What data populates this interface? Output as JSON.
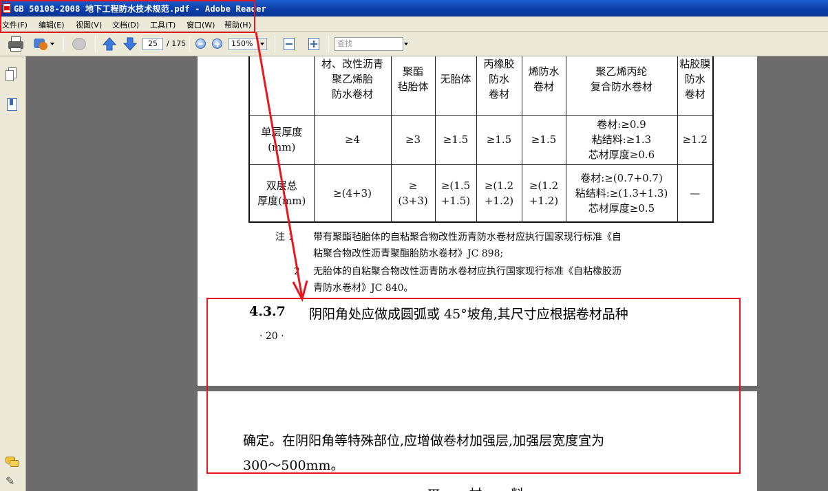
{
  "window": {
    "title": "GB 50108-2008 地下工程防水技术规范.pdf - Adobe Reader"
  },
  "menu": [
    "文件(F)",
    "编辑(E)",
    "视图(V)",
    "文档(D)",
    "工具(T)",
    "窗口(W)",
    "帮助(H)"
  ],
  "toolbar": {
    "page_current": "25",
    "page_total": "/ 175",
    "zoom": "150%",
    "search_placeholder": "查找"
  },
  "table": {
    "header": [
      [
        "材、改性沥青",
        "聚乙烯胎",
        "防水卷材"
      ],
      [
        "聚酯",
        "毡胎体"
      ],
      [
        "无胎体"
      ],
      [
        "丙橡胶",
        "防水",
        "卷材"
      ],
      [
        "烯防水",
        "卷材"
      ],
      [
        "聚乙烯丙纶",
        "复合防水卷材"
      ],
      [
        "粘胶膜",
        "防水",
        "卷材"
      ]
    ],
    "rows": [
      {
        "label": [
          "单层厚度",
          "(mm)"
        ],
        "cells": [
          [
            "≥4"
          ],
          [
            "≥3"
          ],
          [
            "≥1.5"
          ],
          [
            "≥1.5"
          ],
          [
            "≥1.5"
          ],
          [
            "卷材:≥0.9",
            "粘结料:≥1.3",
            "芯材厚度≥0.6"
          ],
          [
            "≥1.2"
          ]
        ]
      },
      {
        "label": [
          "双层总",
          "厚度(mm)"
        ],
        "cells": [
          [
            "≥(4+3)"
          ],
          [
            "≥",
            "(3+3)"
          ],
          [
            "≥(1.5",
            "+1.5)"
          ],
          [
            "≥(1.2",
            "+1.2)"
          ],
          [
            "≥(1.2",
            "+1.2)"
          ],
          [
            "卷材:≥(0.7+0.7)",
            "粘结料:≥(1.3+1.3)",
            "芯材厚度≥0.5"
          ],
          [
            "—"
          ]
        ]
      }
    ]
  },
  "notes": {
    "label": "注 1",
    "line1": "带有聚酯毡胎体的自粘聚合物改性沥青防水卷材应执行国家现行标准《自",
    "line2": "粘聚合物改性沥青聚酯胎防水卷材》JC 898;",
    "num2": "2",
    "line3": "无胎体的自粘聚合物改性沥青防水卷材应执行国家现行标准《自粘橡胶沥",
    "line4": "青防水卷材》JC 840。"
  },
  "clause": {
    "number": "4.3.7",
    "text_line1": "阴阳角处应做成圆弧或 45°坡角,其尺寸应根据卷材品种",
    "page_number": "· 20 ·",
    "text_line2": "确定。在阴阳角等特殊部位,应增做卷材加强层,加强层宽度宜为",
    "text_line3": "300～500mm。"
  },
  "next_section": "Ⅲ 材 料",
  "colors": {
    "annotation_red": "#e8171e",
    "titlebar_blue": "#0b3ea8"
  }
}
